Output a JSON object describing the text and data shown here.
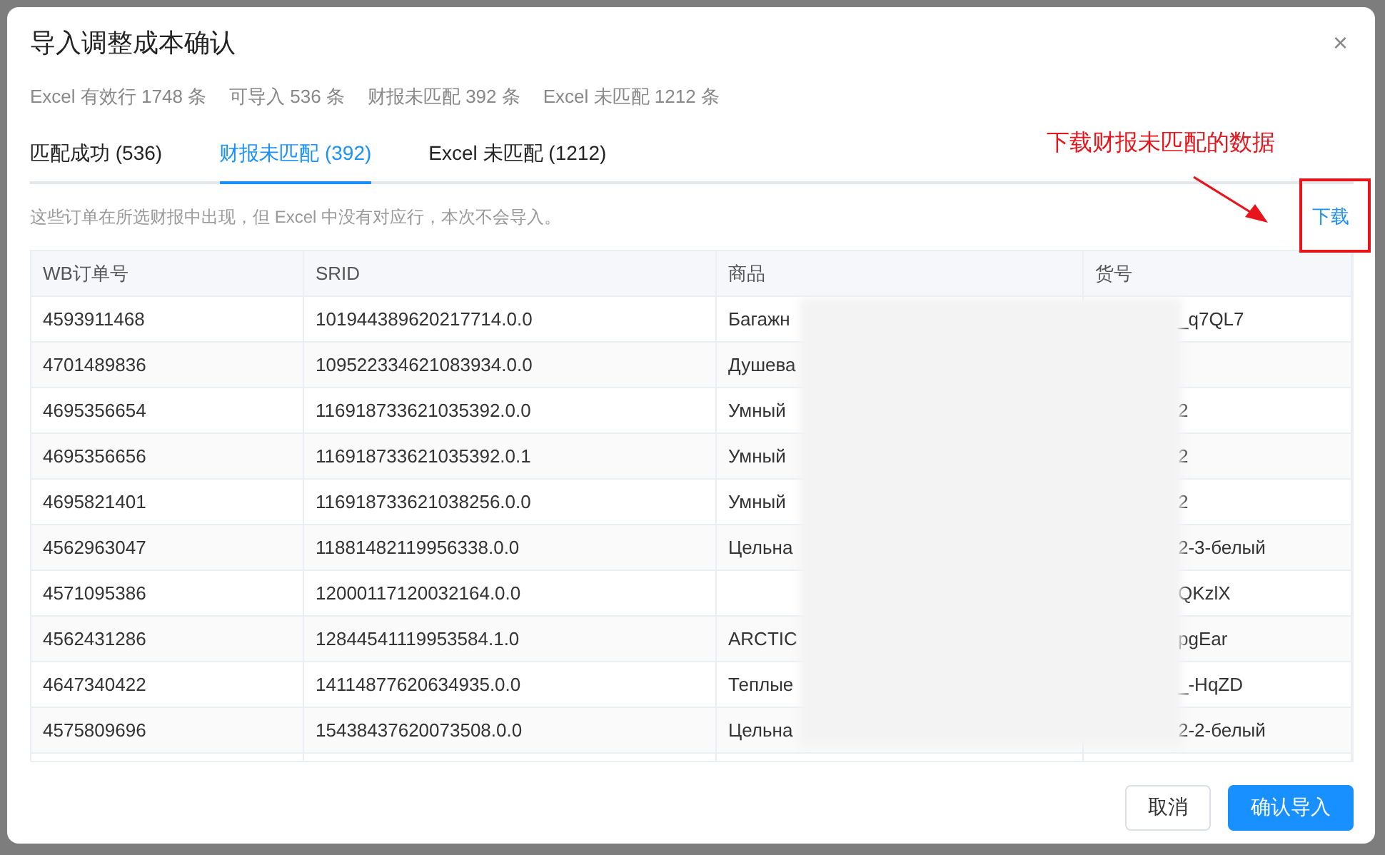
{
  "dialog": {
    "title": "导入调整成本确认",
    "close": "×"
  },
  "stats": [
    "Excel 有效行 1748 条",
    "可导入 536 条",
    "财报未匹配 392 条",
    "Excel 未匹配 1212 条"
  ],
  "tabs": [
    {
      "label": "匹配成功 (536)",
      "selected": false
    },
    {
      "label": "财报未匹配 (392)",
      "selected": true
    },
    {
      "label": "Excel 未匹配 (1212)",
      "selected": false
    }
  ],
  "note": "这些订单在所选财报中出现，但 Excel 中没有对应行，本次不会导入。",
  "download_link": "下载",
  "annotation": {
    "text": "下载财报未匹配的数据"
  },
  "table": {
    "columns": [
      "WB订单号",
      "SRID",
      "商品",
      "货号"
    ],
    "rows": [
      {
        "order": "4593911468",
        "srid": "101944389620217714.0.0",
        "product": "Багажн",
        "sku": "_q7QL7"
      },
      {
        "order": "4701489836",
        "srid": "109522334621083934.0.0",
        "product": "Душева"
      },
      {
        "order": "4695356654",
        "srid": "116918733621035392.0.0",
        "product": "Умный",
        "sku": "2"
      },
      {
        "order": "4695356656",
        "srid": "116918733621035392.0.1",
        "product": "Умный",
        "sku": "2"
      },
      {
        "order": "4695821401",
        "srid": "116918733621038256.0.0",
        "product": "Умный",
        "sku": "2"
      },
      {
        "order": "4562963047",
        "srid": "11881482119956338.0.0",
        "product": "Цельна",
        "sku": "2-3-белый"
      },
      {
        "order": "4571095386",
        "srid": "12000117120032164.0.0",
        "sku": "QKzlX"
      },
      {
        "order": "4562431286",
        "srid": "12844541119953584.1.0",
        "product": "ARCTIC",
        "sku": "pgEar"
      },
      {
        "order": "4647340422",
        "srid": "14114877620634935.0.0",
        "product": "Теплые",
        "sku": "_-HqZD"
      },
      {
        "order": "4575809696",
        "srid": "15438437620073508.0.0",
        "product": "Цельна",
        "sku": "2-2-белый"
      }
    ]
  },
  "buttons": [
    {
      "label": "取消",
      "kind": "secondary"
    },
    {
      "label": "确认导入",
      "kind": "primary"
    }
  ]
}
